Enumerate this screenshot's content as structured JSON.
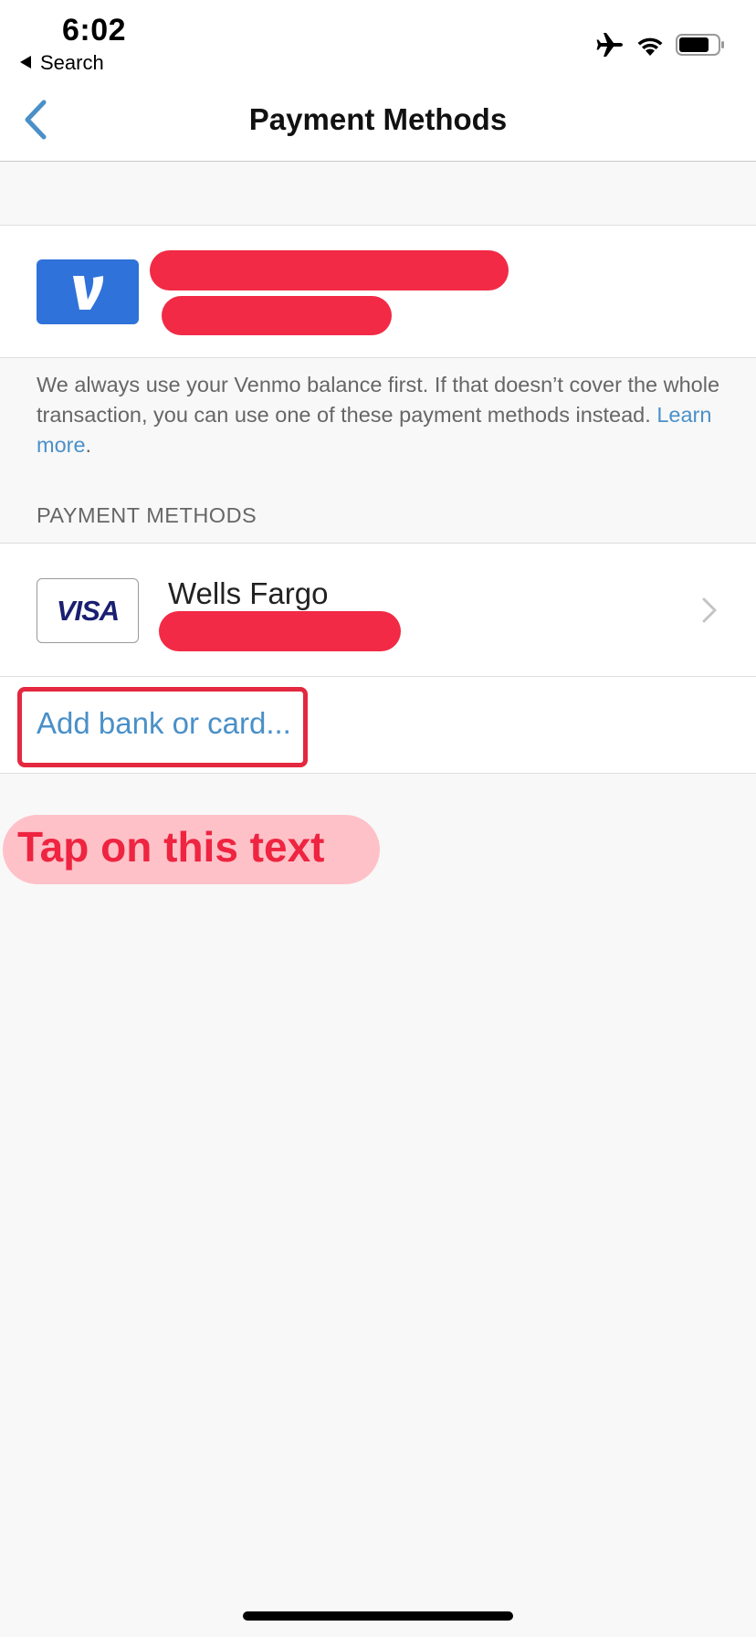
{
  "status_bar": {
    "time": "6:02",
    "back_label": "Search",
    "icons": [
      "airplane-icon",
      "wifi-icon",
      "battery-icon"
    ]
  },
  "nav": {
    "title": "Payment Methods",
    "back_icon": "chevron-left-icon"
  },
  "balance": {
    "logo_letter": "V",
    "logo_color": "#2f72d9"
  },
  "info": {
    "text": "We always use your Venmo balance first. If that doesn’t cover the whole transaction, you can use one of these payment methods instead. ",
    "link": "Learn more",
    "period": "."
  },
  "section": {
    "header": "PAYMENT METHODS"
  },
  "methods": [
    {
      "brand": "VISA",
      "name": "Wells Fargo"
    }
  ],
  "add_method": {
    "label": "Add bank or card..."
  },
  "annotation": {
    "text": "Tap on this text",
    "color": "#ee2440"
  },
  "colors": {
    "accent_link": "#4a90c8",
    "redaction": "#f22a45",
    "visa_blue": "#1a1f71"
  }
}
